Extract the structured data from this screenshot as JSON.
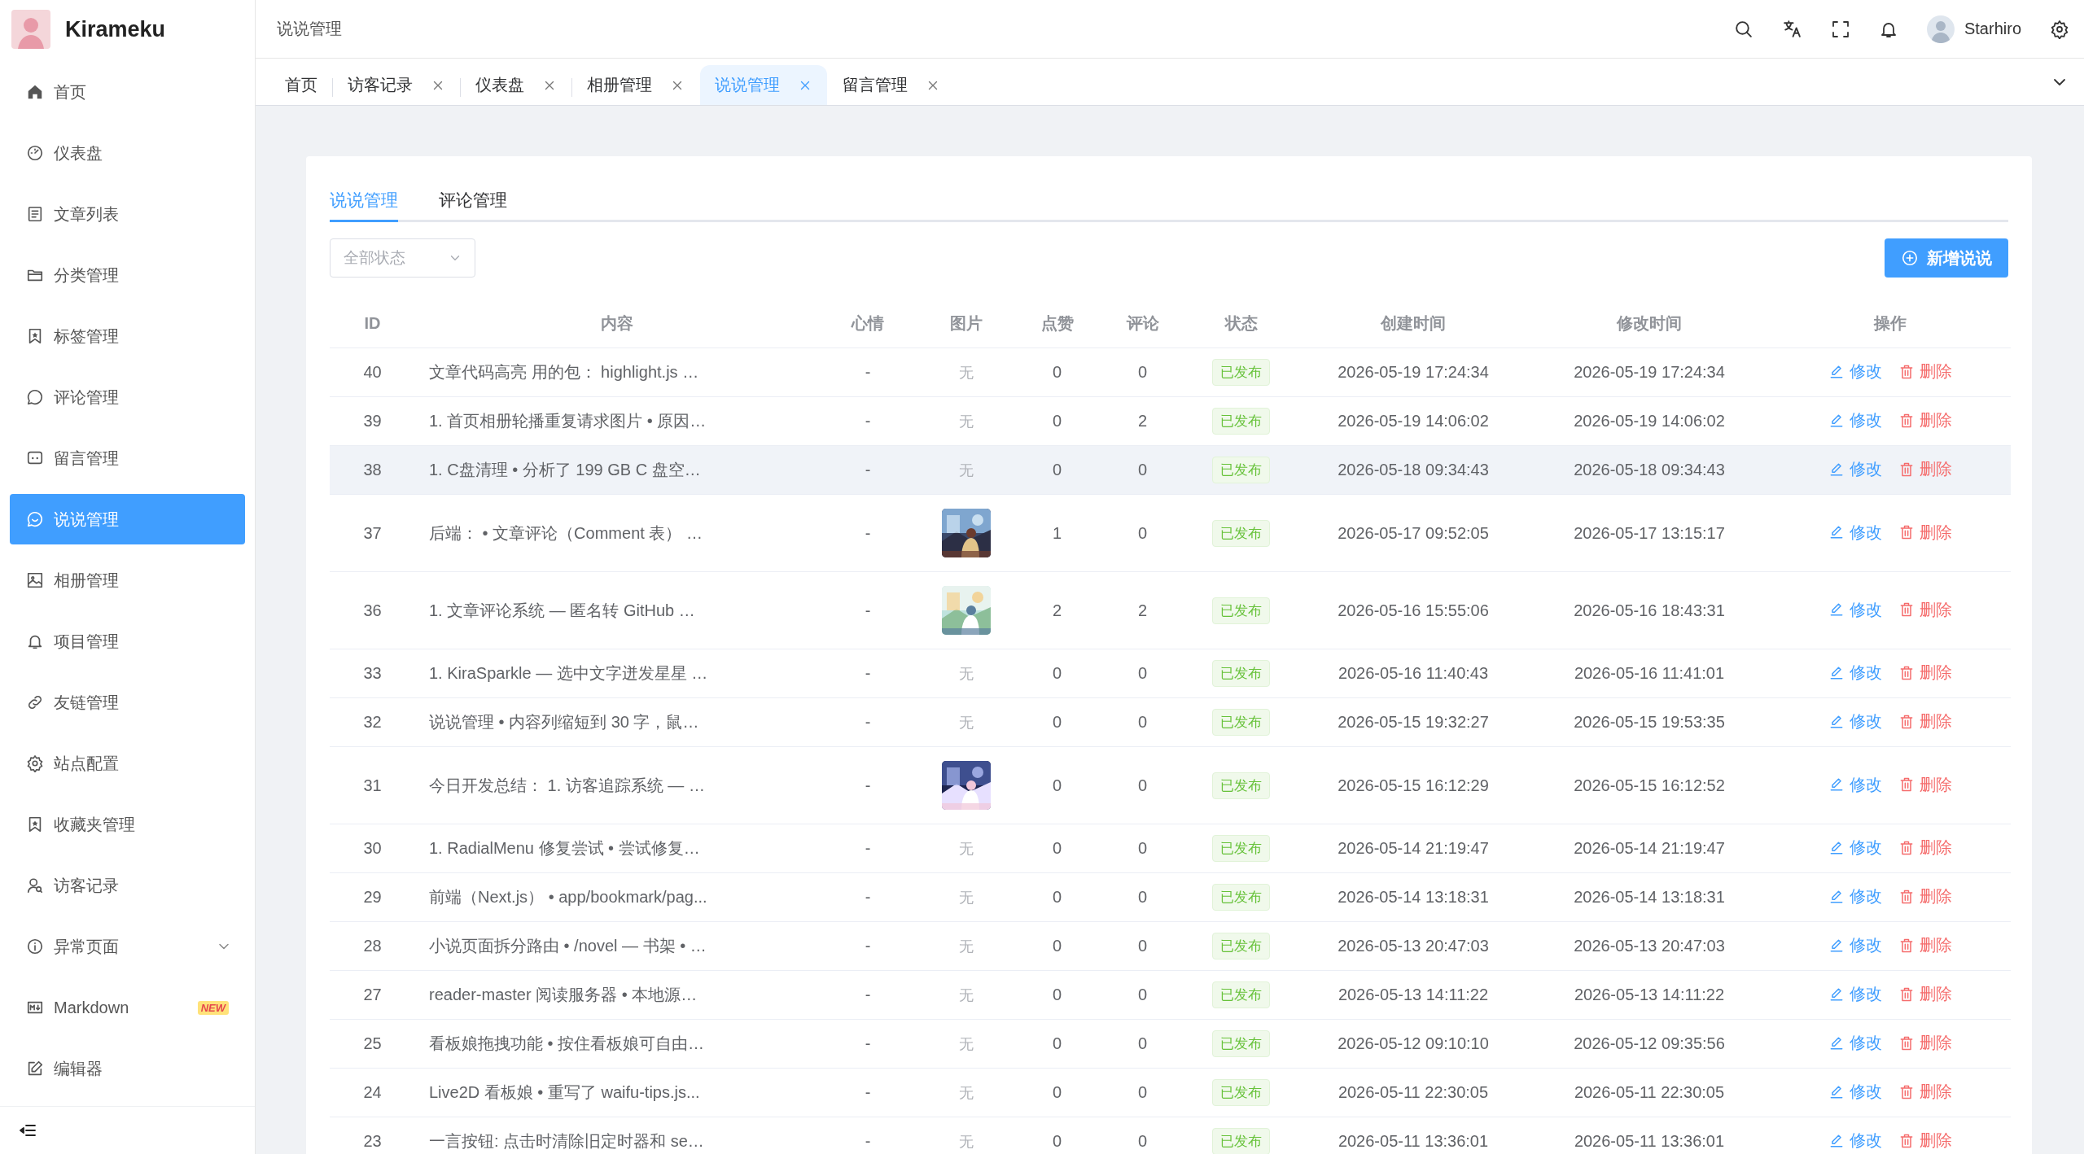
{
  "sidebar": {
    "brand": "Kirameku",
    "items": [
      {
        "label": "首页",
        "kind": "link",
        "selected": false
      },
      {
        "label": "仪表盘",
        "kind": "link",
        "selected": false
      },
      {
        "label": "文章列表",
        "kind": "link",
        "selected": false
      },
      {
        "label": "分类管理",
        "kind": "link",
        "selected": false
      },
      {
        "label": "标签管理",
        "kind": "link",
        "selected": false
      },
      {
        "label": "评论管理",
        "kind": "link",
        "selected": false
      },
      {
        "label": "留言管理",
        "kind": "link",
        "selected": false
      },
      {
        "label": "说说管理",
        "kind": "link",
        "selected": true
      },
      {
        "label": "相册管理",
        "kind": "link",
        "selected": false
      },
      {
        "label": "项目管理",
        "kind": "link",
        "selected": false
      },
      {
        "label": "友链管理",
        "kind": "link",
        "selected": false
      },
      {
        "label": "站点配置",
        "kind": "link",
        "selected": false
      },
      {
        "label": "收藏夹管理",
        "kind": "link",
        "selected": false
      },
      {
        "label": "访客记录",
        "kind": "link",
        "selected": false
      },
      {
        "label": "异常页面",
        "kind": "submenu",
        "selected": false,
        "expanded": false
      },
      {
        "label": "Markdown",
        "kind": "link",
        "selected": false,
        "badge": "NEW"
      },
      {
        "label": "编辑器",
        "kind": "link",
        "selected": false
      }
    ]
  },
  "header": {
    "breadcrumb": "说说管理",
    "user": "Starhiro"
  },
  "tabs": [
    {
      "label": "首页",
      "selected": false,
      "closable": false
    },
    {
      "label": "访客记录",
      "selected": false,
      "closable": true
    },
    {
      "label": "仪表盘",
      "selected": false,
      "closable": true
    },
    {
      "label": "相册管理",
      "selected": false,
      "closable": true
    },
    {
      "label": "说说管理",
      "selected": true,
      "closable": true
    },
    {
      "label": "留言管理",
      "selected": false,
      "closable": true
    }
  ],
  "panel": {
    "tabs": [
      {
        "label": "说说管理",
        "selected": true
      },
      {
        "label": "评论管理",
        "selected": false
      }
    ],
    "filter": {
      "placeholder": "全部状态"
    },
    "add_button": "新增说说",
    "table": {
      "columns": [
        "ID",
        "内容",
        "心情",
        "图片",
        "点赞",
        "评论",
        "状态",
        "创建时间",
        "修改时间",
        "操作"
      ],
      "rows": [
        {
          "id": "40",
          "content": "文章代码高亮 用的包： highlight.js …",
          "mood": "-",
          "image": "无",
          "likes": "0",
          "comments": "0",
          "status": "已发布",
          "created": "2026-05-19 17:24:34",
          "modified": "2026-05-19 17:24:34",
          "edit": "修改",
          "delete": "删除",
          "highlighted": false
        },
        {
          "id": "39",
          "content": "1. 首页相册轮播重复请求图片 • 原因…",
          "mood": "-",
          "image": "无",
          "likes": "0",
          "comments": "2",
          "status": "已发布",
          "created": "2026-05-19 14:06:02",
          "modified": "2026-05-19 14:06:02",
          "edit": "修改",
          "delete": "删除",
          "highlighted": false
        },
        {
          "id": "38",
          "content": "1. C盘清理 • 分析了 199 GB C 盘空…",
          "mood": "-",
          "image": "无",
          "likes": "0",
          "comments": "0",
          "status": "已发布",
          "created": "2026-05-18 09:34:43",
          "modified": "2026-05-18 09:34:43",
          "edit": "修改",
          "delete": "删除",
          "highlighted": true
        },
        {
          "id": "37",
          "content": "后端： • 文章评论（Comment 表） …",
          "mood": "-",
          "likes": "1",
          "comments": "0",
          "status": "已发布",
          "created": "2026-05-17 09:52:05",
          "modified": "2026-05-17 13:15:17",
          "edit": "修改",
          "delete": "删除",
          "highlighted": false
        },
        {
          "id": "36",
          "content": "1. 文章评论系统 — 匿名转 GitHub …",
          "mood": "-",
          "likes": "2",
          "comments": "2",
          "status": "已发布",
          "created": "2026-05-16 15:55:06",
          "modified": "2026-05-16 18:43:31",
          "edit": "修改",
          "delete": "删除",
          "highlighted": false
        },
        {
          "id": "33",
          "content": "1. KiraSparkle — 选中文字迸发星星 …",
          "mood": "-",
          "image": "无",
          "likes": "0",
          "comments": "0",
          "status": "已发布",
          "created": "2026-05-16 11:40:43",
          "modified": "2026-05-16 11:41:01",
          "edit": "修改",
          "delete": "删除",
          "highlighted": false
        },
        {
          "id": "32",
          "content": "说说管理 • 内容列缩短到 30 字，鼠…",
          "mood": "-",
          "image": "无",
          "likes": "0",
          "comments": "0",
          "status": "已发布",
          "created": "2026-05-15 19:32:27",
          "modified": "2026-05-15 19:53:35",
          "edit": "修改",
          "delete": "删除",
          "highlighted": false
        },
        {
          "id": "31",
          "content": "今日开发总结： 1. 访客追踪系统 — …",
          "mood": "-",
          "likes": "0",
          "comments": "0",
          "status": "已发布",
          "created": "2026-05-15 16:12:29",
          "modified": "2026-05-15 16:12:52",
          "edit": "修改",
          "delete": "删除",
          "highlighted": false
        },
        {
          "id": "30",
          "content": "1. RadialMenu 修复尝试 • 尝试修复…",
          "mood": "-",
          "image": "无",
          "likes": "0",
          "comments": "0",
          "status": "已发布",
          "created": "2026-05-14 21:19:47",
          "modified": "2026-05-14 21:19:47",
          "edit": "修改",
          "delete": "删除",
          "highlighted": false
        },
        {
          "id": "29",
          "content": "前端（Next.js） • app/bookmark/pag...",
          "mood": "-",
          "image": "无",
          "likes": "0",
          "comments": "0",
          "status": "已发布",
          "created": "2026-05-14 13:18:31",
          "modified": "2026-05-14 13:18:31",
          "edit": "修改",
          "delete": "删除",
          "highlighted": false
        },
        {
          "id": "28",
          "content": "小说页面拆分路由 • /novel — 书架 • …",
          "mood": "-",
          "image": "无",
          "likes": "0",
          "comments": "0",
          "status": "已发布",
          "created": "2026-05-13 20:47:03",
          "modified": "2026-05-13 20:47:03",
          "edit": "修改",
          "delete": "删除",
          "highlighted": false
        },
        {
          "id": "27",
          "content": "reader-master 阅读服务器 • 本地源…",
          "mood": "-",
          "image": "无",
          "likes": "0",
          "comments": "0",
          "status": "已发布",
          "created": "2026-05-13 14:11:22",
          "modified": "2026-05-13 14:11:22",
          "edit": "修改",
          "delete": "删除",
          "highlighted": false
        },
        {
          "id": "25",
          "content": "看板娘拖拽功能 • 按住看板娘可自由…",
          "mood": "-",
          "image": "无",
          "likes": "0",
          "comments": "0",
          "status": "已发布",
          "created": "2026-05-12 09:10:10",
          "modified": "2026-05-12 09:35:56",
          "edit": "修改",
          "delete": "删除",
          "highlighted": false
        },
        {
          "id": "24",
          "content": "Live2D 看板娘 • 重写了 waifu-tips.js...",
          "mood": "-",
          "image": "无",
          "likes": "0",
          "comments": "0",
          "status": "已发布",
          "created": "2026-05-11 22:30:05",
          "modified": "2026-05-11 22:30:05",
          "edit": "修改",
          "delete": "删除",
          "highlighted": false
        },
        {
          "id": "23",
          "content": "一言按钮: 点击时清除旧定时器和 se…",
          "mood": "-",
          "image": "无",
          "likes": "0",
          "comments": "0",
          "status": "已发布",
          "created": "2026-05-11 13:36:01",
          "modified": "2026-05-11 13:36:01",
          "edit": "修改",
          "delete": "删除",
          "highlighted": false
        }
      ]
    }
  }
}
